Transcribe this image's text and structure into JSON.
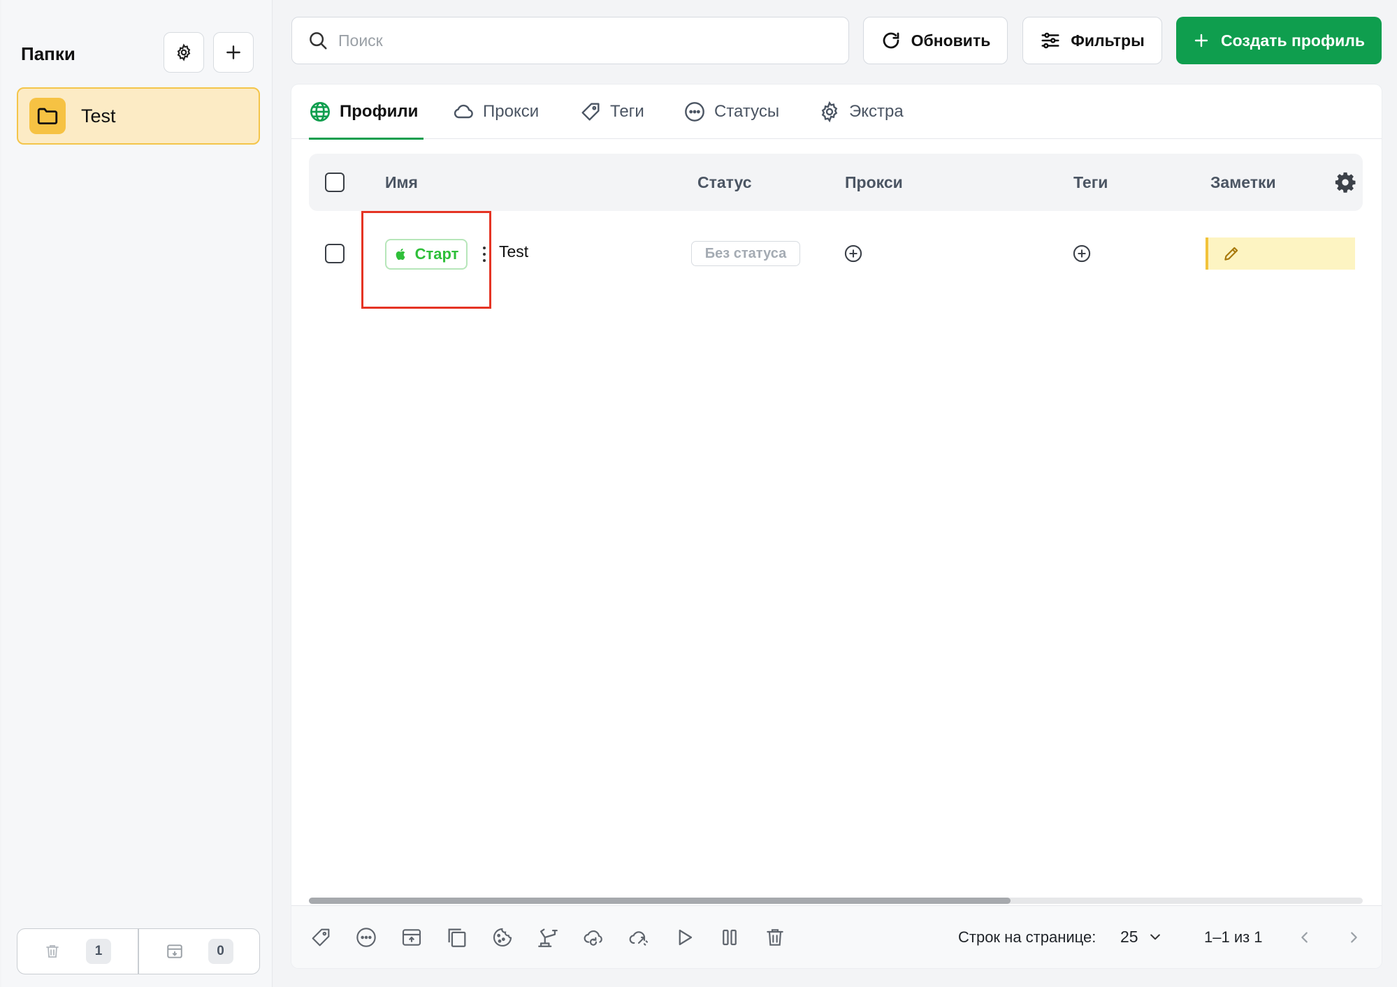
{
  "sidebar": {
    "title": "Папки",
    "folders": [
      {
        "label": "Test"
      }
    ],
    "trash_count": "1",
    "archive_count": "0"
  },
  "topbar": {
    "search_placeholder": "Поиск",
    "refresh_label": "Обновить",
    "filters_label": "Фильтры",
    "create_label": "Создать профиль"
  },
  "tabs": [
    {
      "label": "Профили",
      "active": true
    },
    {
      "label": "Прокси"
    },
    {
      "label": "Теги"
    },
    {
      "label": "Статусы"
    },
    {
      "label": "Экстра"
    }
  ],
  "table": {
    "columns": [
      "Имя",
      "Статус",
      "Прокси",
      "Теги",
      "Заметки"
    ],
    "rows": [
      {
        "start_label": "Старт",
        "name": "Test",
        "status": "Без статуса"
      }
    ]
  },
  "footer": {
    "rows_per_page_label": "Строк на странице:",
    "rows_per_page_value": "25",
    "page_info": "1–1 из 1"
  },
  "colors": {
    "accent_green": "#0f9e4e",
    "start_green": "#2fbf3a",
    "folder_yellow": "#f6c243",
    "highlight_red": "#e53424"
  }
}
